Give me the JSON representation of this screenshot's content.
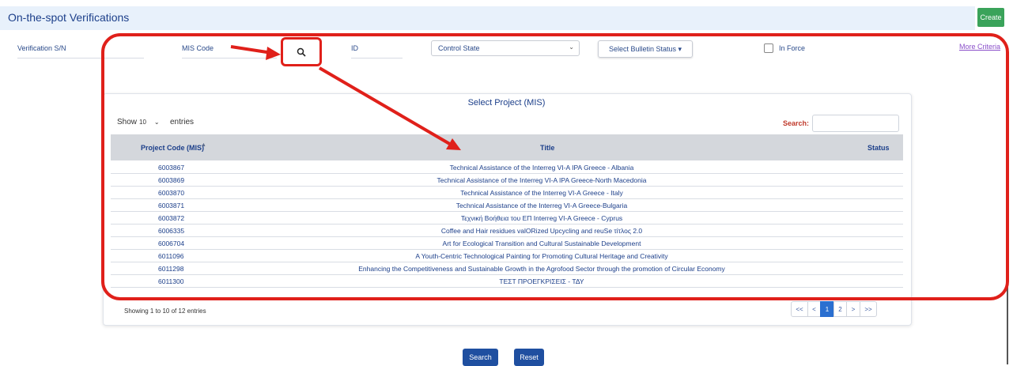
{
  "header": {
    "title": "On-the-spot Verifications",
    "create_label": "Create"
  },
  "filters": {
    "verification_sn_label": "Verification S/N",
    "mis_code_label": "MIS Code",
    "id_label": "ID",
    "control_state_value": "Control State",
    "bulletin_status_label": "Select Bulletin Status ▾",
    "in_force_label": "In Force",
    "more_criteria_label": "More Criteria"
  },
  "project_modal": {
    "title": "Select Project (MIS)",
    "show_label": "Show",
    "entries_value": "10",
    "entries_label": "entries",
    "search_label": "Search:",
    "columns": [
      "Project Code (MIS)",
      "Title",
      "Status"
    ],
    "sort_indicator": "▲",
    "rows": [
      {
        "code": "6003867",
        "title": "Technical Assistance of the Interreg VI-A IPA Greece - Albania"
      },
      {
        "code": "6003869",
        "title": "Technical Assistance of the Interreg VI-A IPA Greece-North Macedonia"
      },
      {
        "code": "6003870",
        "title": "Technical Assistance of the Interreg VI-A Greece - Italy"
      },
      {
        "code": "6003871",
        "title": "Technical Assistance of the Interreg VI-A Greece-Bulgaria"
      },
      {
        "code": "6003872",
        "title": "Τεχνική Βοήθεια του ΕΠ Interreg VI-A Greece - Cyprus"
      },
      {
        "code": "6006335",
        "title": "Coffee and Hair residues valORized Upcycling and reuSe τίτλος 2.0"
      },
      {
        "code": "6006704",
        "title": "Art for Ecological Transition and Cultural Sustainable Development"
      },
      {
        "code": "6011096",
        "title": "A Youth-Centric Technological Painting for Promoting Cultural Heritage and Creativity"
      },
      {
        "code": "6011298",
        "title": "Enhancing the Competitiveness and Sustainable Growth in the Agrofood Sector through the promotion of Circular Economy"
      },
      {
        "code": "6011300",
        "title": "ΤΕΣΤ ΠΡΟΕΓΚΡΙΣΕΙΣ - ΤΔΥ"
      }
    ],
    "showing_label": "Showing 1 to 10 of 12 entries",
    "pagination": {
      "first": "<<",
      "prev": "<",
      "page1": "1",
      "page2": "2",
      "next": ">",
      "last": ">>"
    }
  },
  "actions": {
    "search_label": "Search",
    "reset_label": "Reset"
  },
  "icons": {
    "search": "search-icon",
    "chevron": "chevron-down-icon",
    "checkbox": "checkbox-icon"
  },
  "colors": {
    "annotation_red": "#e0201a",
    "primary_blue": "#1f4fa0",
    "create_green": "#3aa35a"
  }
}
